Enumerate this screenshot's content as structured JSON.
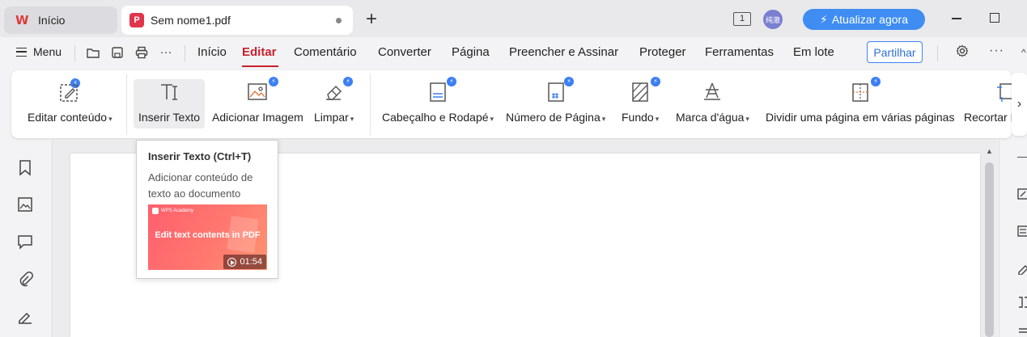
{
  "titlebar": {
    "home_tab": "Início",
    "doc_tab": "Sem nome1.pdf",
    "window_count": "1",
    "avatar_text": "纯澈",
    "upgrade_label": "Atualizar agora"
  },
  "menubar": {
    "menu_label": "Menu",
    "items": [
      "Início",
      "Editar",
      "Comentário",
      "Converter",
      "Página",
      "Preencher e Assinar",
      "Proteger",
      "Ferramentas",
      "Em lote"
    ],
    "active_item": "Editar",
    "share_label": "Partilhar"
  },
  "ribbon": {
    "buttons": [
      {
        "label": "Editar conteúdo",
        "dropdown": true
      },
      {
        "label": "Inserir Texto",
        "dropdown": false
      },
      {
        "label": "Adicionar Imagem",
        "dropdown": false
      },
      {
        "label": "Limpar",
        "dropdown": true
      },
      {
        "label": "Cabeçalho e Rodapé",
        "dropdown": true
      },
      {
        "label": "Número de Página",
        "dropdown": true
      },
      {
        "label": "Fundo",
        "dropdown": true
      },
      {
        "label": "Marca d'água",
        "dropdown": true
      },
      {
        "label": "Dividir uma página em várias páginas",
        "dropdown": false
      },
      {
        "label": "Recortar Página",
        "dropdown": false
      }
    ]
  },
  "tooltip": {
    "title": "Inserir Texto (Ctrl+T)",
    "description": "Adicionar conteúdo de texto ao documento",
    "video_brand": "WPS Academy",
    "video_caption": "Edit text contents in PDF",
    "video_duration": "01:54"
  },
  "colors": {
    "accent_red": "#c8202d",
    "upgrade_blue": "#3f8df2",
    "premium_badge": "#3b7ff3"
  }
}
